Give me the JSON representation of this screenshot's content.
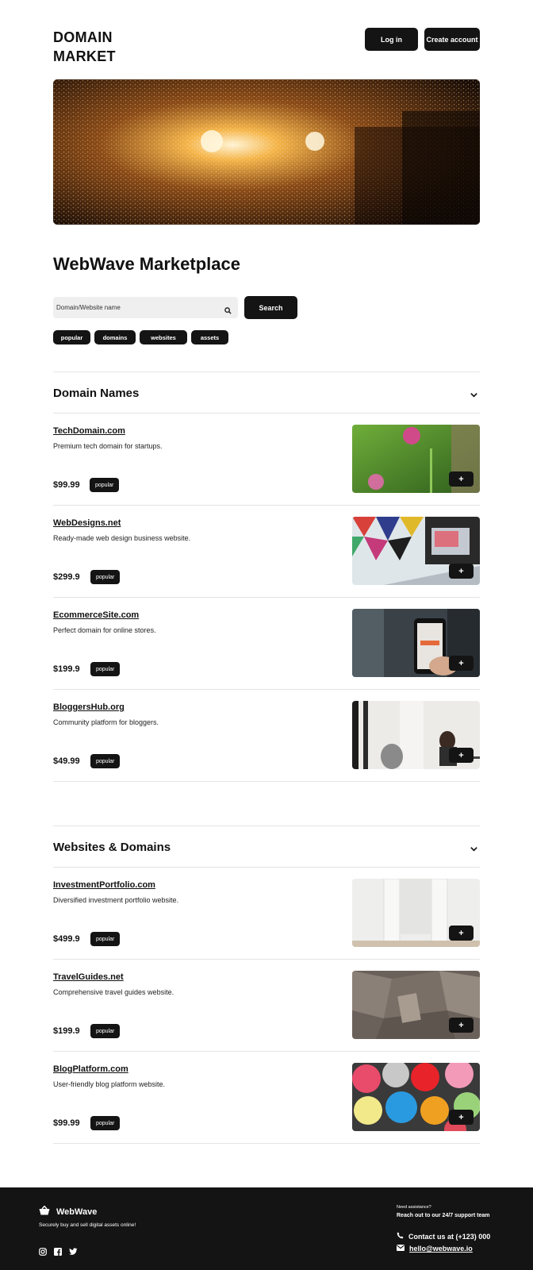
{
  "header": {
    "logo": "DOMAIN\nMARKET",
    "login_label": "Log in",
    "create_label": "Create account"
  },
  "title": "WebWave Marketplace",
  "search": {
    "placeholder": "Domain/Website name",
    "button_label": "Search"
  },
  "tags": [
    "popular",
    "domains",
    "websites",
    "assets"
  ],
  "sections": [
    {
      "title": "Domain Names",
      "items": [
        {
          "name": "TechDomain.com",
          "desc": "Premium tech domain for startups.",
          "price": "$99.99",
          "badge": "popular"
        },
        {
          "name": "WebDesigns.net",
          "desc": "Ready-made web design business website.",
          "price": "$299.9",
          "badge": "popular"
        },
        {
          "name": "EcommerceSite.com",
          "desc": "Perfect domain for online stores.",
          "price": "$199.9",
          "badge": "popular"
        },
        {
          "name": "BloggersHub.org",
          "desc": "Community platform for bloggers.",
          "price": "$49.99",
          "badge": "popular"
        }
      ]
    },
    {
      "title": "Websites & Domains",
      "items": [
        {
          "name": "InvestmentPortfolio.com",
          "desc": "Diversified investment portfolio website.",
          "price": "$499.9",
          "badge": "popular"
        },
        {
          "name": "TravelGuides.net",
          "desc": "Comprehensive travel guides website.",
          "price": "$199.9",
          "badge": "popular"
        },
        {
          "name": "BlogPlatform.com",
          "desc": "User-friendly blog platform website.",
          "price": "$99.99",
          "badge": "popular"
        }
      ]
    }
  ],
  "add_label": "+",
  "footer": {
    "brand": "WebWave",
    "tagline": "Securely buy and sell digital assets online!",
    "need_help": "Need assistance?",
    "reach_out": "Reach out to our 24/7 support team",
    "phone": "Contact us at (+123) 000",
    "email": "hello@webwave.io"
  }
}
